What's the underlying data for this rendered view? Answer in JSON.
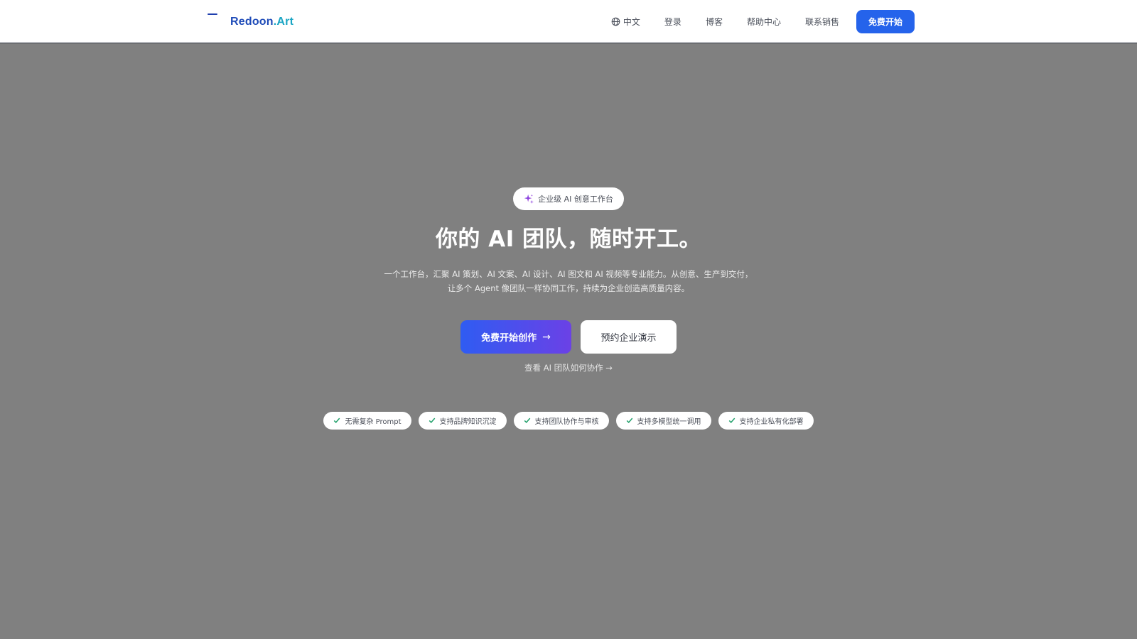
{
  "brand": {
    "name_part1": "Redoon",
    "name_part2": ".Art"
  },
  "nav": {
    "language": "中文",
    "items": [
      "登录",
      "博客",
      "帮助中心",
      "联系销售"
    ],
    "cta": "免费开始"
  },
  "hero": {
    "badge": "企业级 AI 创意工作台",
    "title": "你的 AI 团队，随时开工。",
    "subtitle_line1": "一个工作台，汇聚 AI 策划、AI 文案、AI 设计、AI 图文和 AI 视频等专业能力。从创意、生产到交付，",
    "subtitle_line2": "让多个 Agent 像团队一样协同工作，持续为企业创造高质量内容。",
    "primary_button": "免费开始创作",
    "secondary_button": "预约企业演示",
    "link_text": "查看 AI 团队如何协作 →"
  },
  "features": [
    "无需复杂 Prompt",
    "支持品牌知识沉淀",
    "支持团队协作与审核",
    "支持多模型统一调用",
    "支持企业私有化部署"
  ],
  "colors": {
    "accent": "#2563eb",
    "gradient_start": "#2f5cf2",
    "gradient_end": "#6b41e6",
    "check": "#22a06b",
    "overlay": "#808080"
  }
}
